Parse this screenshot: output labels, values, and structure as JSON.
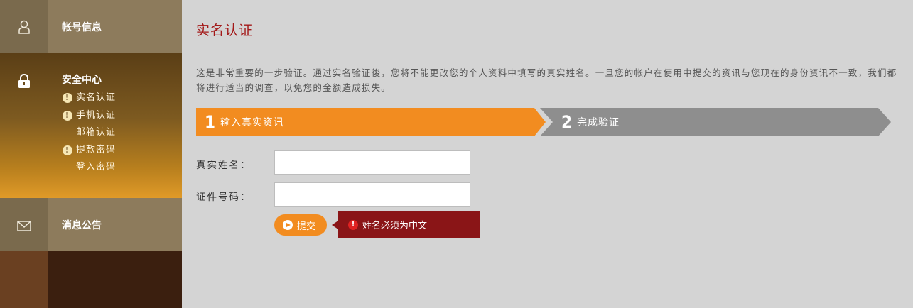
{
  "sidebar": {
    "account": {
      "title": "帐号信息",
      "icon": "person-icon"
    },
    "security": {
      "title": "安全中心",
      "icon": "lock-icon",
      "items": [
        {
          "label": "实名认证",
          "warning": true
        },
        {
          "label": "手机认证",
          "warning": true
        },
        {
          "label": "邮箱认证",
          "warning": false
        },
        {
          "label": "提款密码",
          "warning": true
        },
        {
          "label": "登入密码",
          "warning": false
        }
      ]
    },
    "messages": {
      "title": "消息公告",
      "icon": "envelope-icon"
    }
  },
  "main": {
    "title": "实名认证",
    "intro": "这是非常重要的一步验证。通过实名验证後，您将不能更改您的个人资料中填写的真实姓名。一旦您的帐户在使用中提交的资讯与您现在的身份资讯不一致，我们都将进行适当的调查，以免您的金额造成损失。",
    "steps": [
      {
        "number": "1",
        "label": "输入真实资讯",
        "active": true
      },
      {
        "number": "2",
        "label": "完成验证",
        "active": false
      }
    ],
    "form": {
      "name_label": "真实姓名：",
      "name_value": "",
      "id_label": "证件号码：",
      "id_value": "",
      "submit_label": "提交"
    },
    "error": {
      "message": "姓名必须为中文",
      "icon": "exclamation-icon"
    }
  },
  "colors": {
    "accent": "#f28c20",
    "title_red": "#a31818",
    "error_bg": "#8a1517",
    "step_inactive": "#8e8e8e"
  }
}
